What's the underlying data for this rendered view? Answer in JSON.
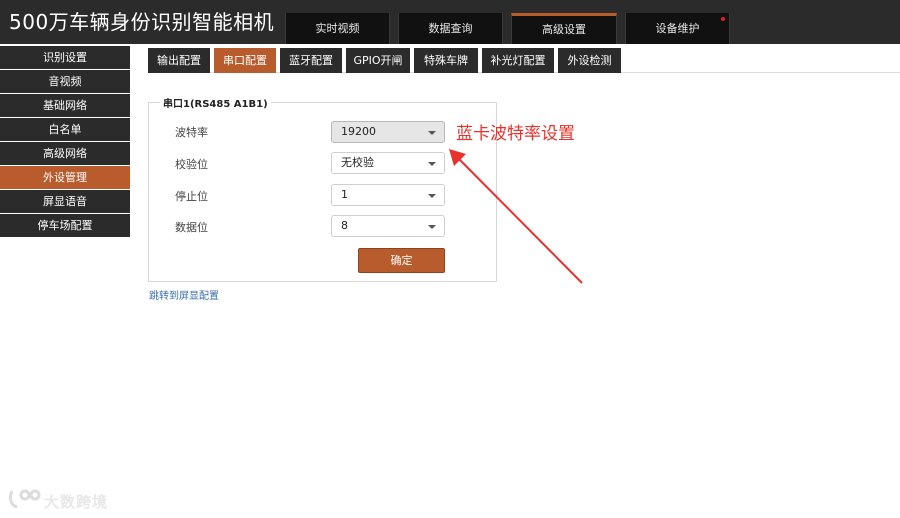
{
  "app_title": "500万车辆身份识别智能相机",
  "main_nav": [
    {
      "label": "实时视频"
    },
    {
      "label": "数据查询"
    },
    {
      "label": "高级设置"
    },
    {
      "label": "设备维护"
    }
  ],
  "sidebar": [
    {
      "label": "识别设置"
    },
    {
      "label": "音视频"
    },
    {
      "label": "基础网络"
    },
    {
      "label": "白名单"
    },
    {
      "label": "高级网络"
    },
    {
      "label": "外设管理"
    },
    {
      "label": "屏显语音"
    },
    {
      "label": "停车场配置"
    }
  ],
  "sub_tabs": [
    {
      "label": "输出配置"
    },
    {
      "label": "串口配置"
    },
    {
      "label": "蓝牙配置"
    },
    {
      "label": "GPIO开闸"
    },
    {
      "label": "特殊车牌"
    },
    {
      "label": "补光灯配置"
    },
    {
      "label": "外设检测"
    }
  ],
  "serial_panel": {
    "legend": "串口1(RS485 A1B1)",
    "fields": [
      {
        "label": "波特率",
        "value": "19200"
      },
      {
        "label": "校验位",
        "value": "无校验"
      },
      {
        "label": "停止位",
        "value": "1"
      },
      {
        "label": "数据位",
        "value": "8"
      }
    ],
    "confirm_label": "确定"
  },
  "jump_link": "跳转到屏显配置",
  "annotation": "蓝卡波特率设置",
  "watermark": "大数跨境",
  "colors": {
    "accent": "#b85c2e",
    "dark_bg": "#2b2b2b",
    "annotation_red": "#e8322b"
  }
}
